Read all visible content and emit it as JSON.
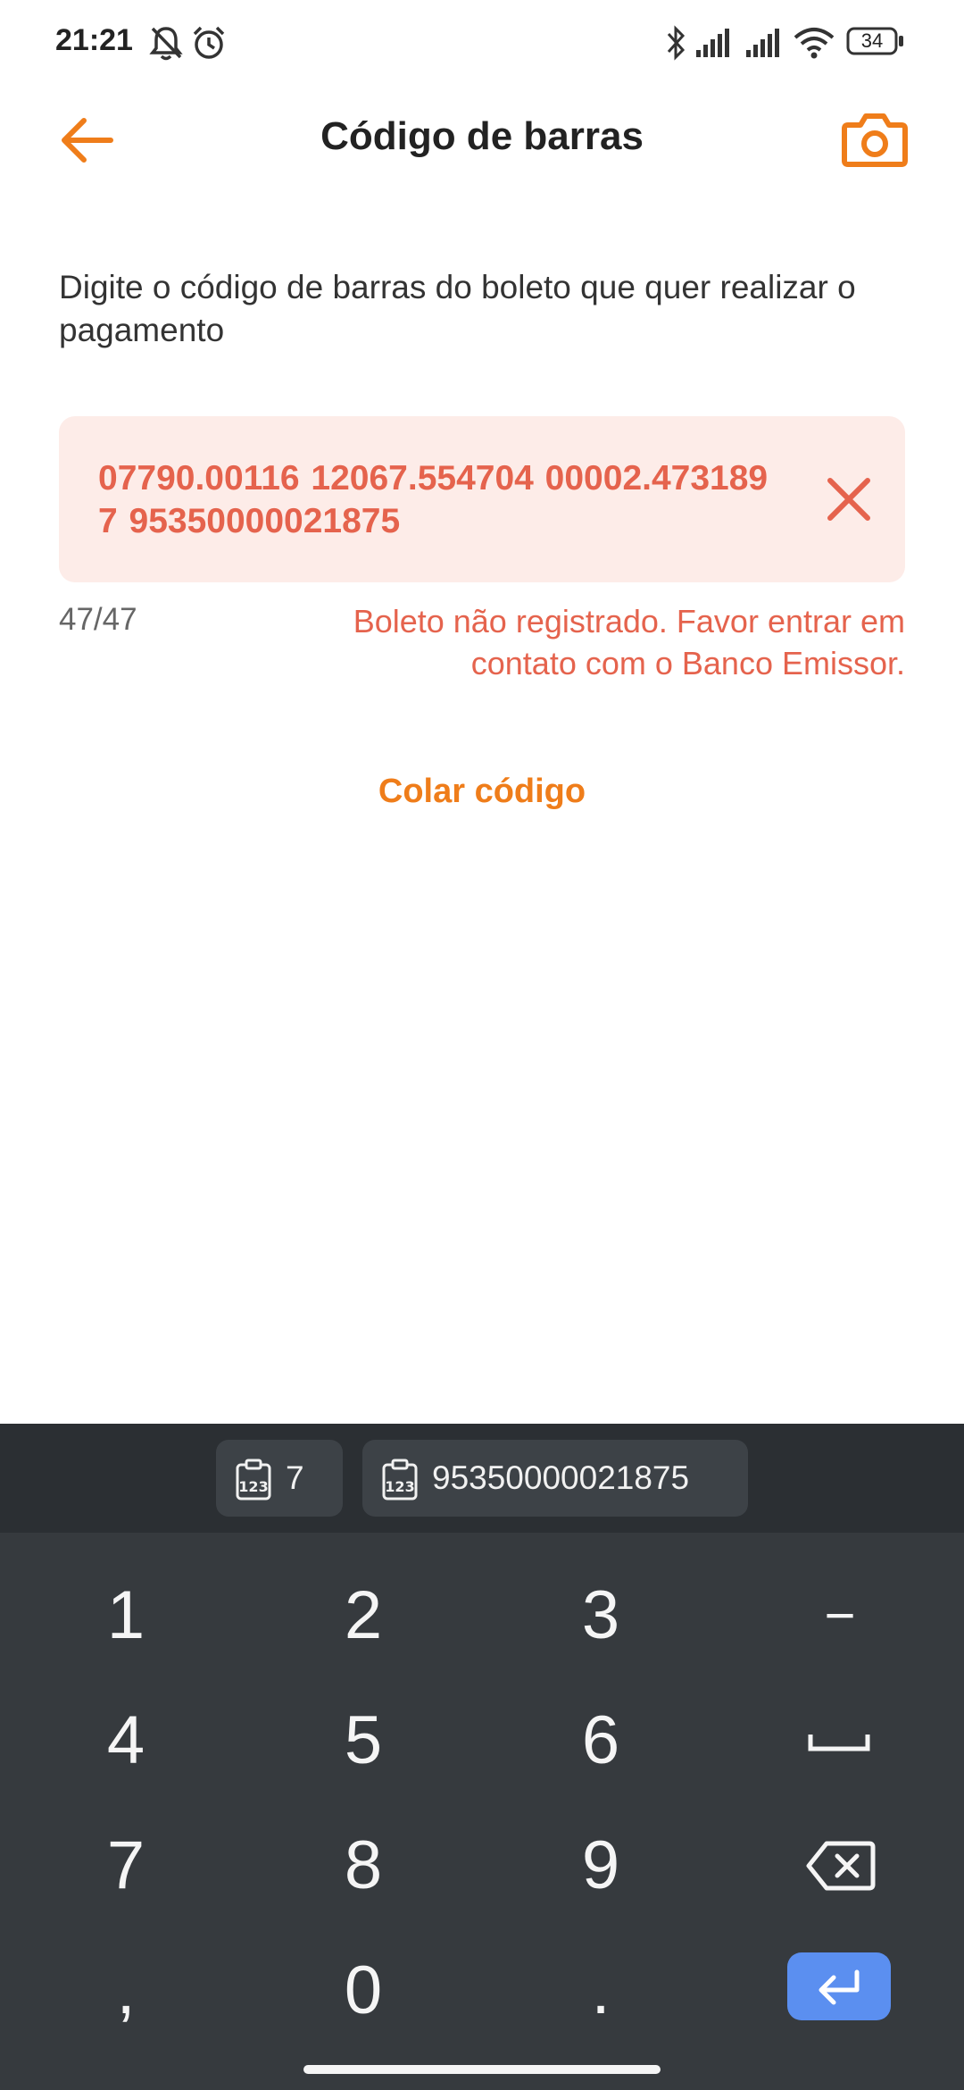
{
  "status_bar": {
    "time": "21:21",
    "battery": "34"
  },
  "header": {
    "title": "Código de barras"
  },
  "instruction": "Digite o código de barras do boleto que quer realizar o pagamento",
  "barcode": {
    "value": "07790.00116 12067.554704 00002.473189 7 95350000021875",
    "counter": "47/47",
    "error": "Boleto não registrado. Favor entrar em contato com o Banco Emissor."
  },
  "paste_label": "Colar código",
  "keyboard": {
    "suggestions": [
      {
        "text": "7",
        "icon": "clipboard-123-icon"
      },
      {
        "text": "95350000021875",
        "icon": "clipboard-123-icon"
      }
    ],
    "keys": [
      "1",
      "2",
      "3",
      "−",
      "4",
      "5",
      "6",
      "7",
      "8",
      "9",
      ",",
      "0",
      "."
    ]
  },
  "colors": {
    "accent": "#ef7d1a",
    "error": "#e5634d",
    "error_bg": "#fdece8",
    "keyboard_bg": "#363a3e",
    "enter": "#5b8ff0"
  }
}
